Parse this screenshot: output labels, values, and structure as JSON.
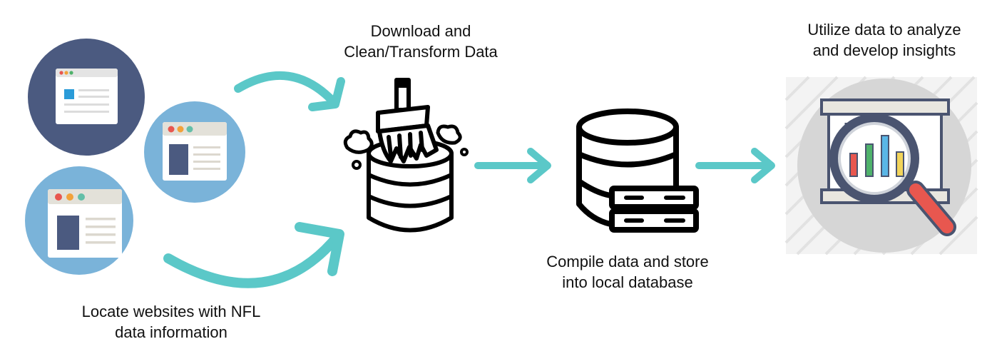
{
  "steps": {
    "locate": {
      "line1": "Locate websites with NFL",
      "line2": "data information"
    },
    "clean": {
      "line1": "Download and",
      "line2": "Clean/Transform Data"
    },
    "compile": {
      "line1": "Compile data and store",
      "line2": "into local database"
    },
    "utilize": {
      "line1": "Utilize data to analyze",
      "line2": "and develop insights"
    }
  },
  "colors": {
    "arrow": "#5bc8c8",
    "navy": "#4b5a80",
    "lightblue": "#7ab3d9",
    "bar_red": "#e8574f",
    "bar_green": "#4fb26b",
    "bar_blue": "#5ab6e6",
    "bar_yellow": "#f2d45a"
  }
}
